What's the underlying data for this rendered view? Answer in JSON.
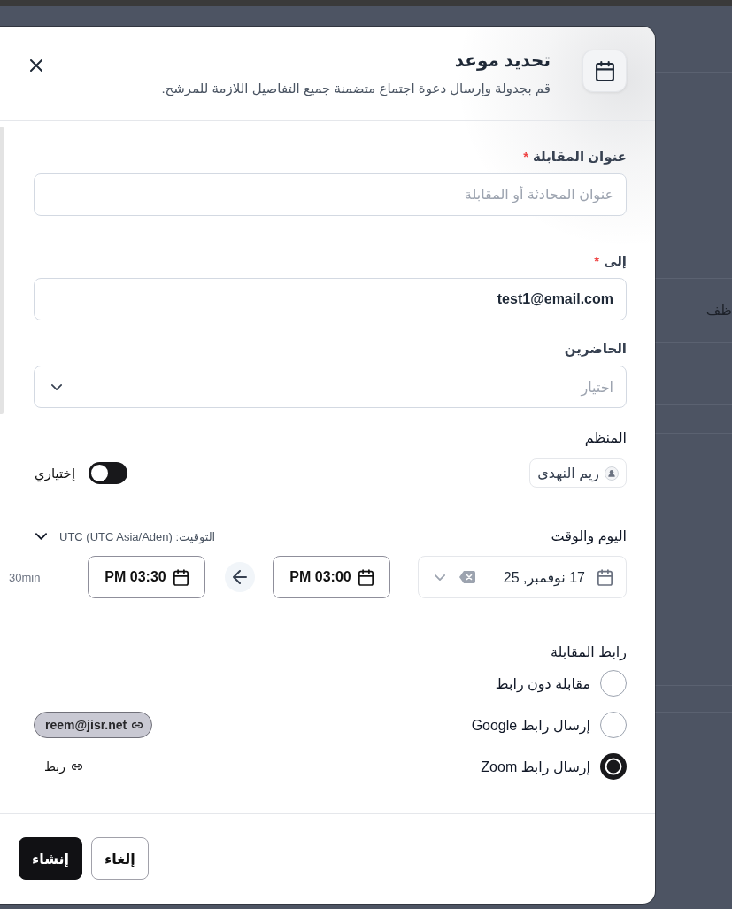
{
  "background": {
    "text": "ظف"
  },
  "dialog": {
    "title": "تحديد موعد",
    "subtitle": "قم بجدولة وإرسال دعوة اجتماع متضمنة جميع التفاصيل اللازمة للمرشح."
  },
  "fields": [
    {
      "kind": "text",
      "label": "عنوان المقابلة",
      "required_mark": "*",
      "placeholder": "عنوان المحادثة أو المقابلة"
    },
    {
      "kind": "text",
      "label": "إلى",
      "required_mark": "*",
      "value": "test1@email.com"
    },
    {
      "kind": "select",
      "label": "الحاضرين",
      "placeholder": "اختيار"
    }
  ],
  "organizer": {
    "label": "المنظم",
    "name": "ريم النهدى",
    "optional": {
      "label": "إختياري",
      "on": false
    }
  },
  "schedule": {
    "label": "اليوم والوقت",
    "timezone": "التوقيت: UTC (UTC Asia/Aden)",
    "date": "17 نوفمبر, 25",
    "start_time": "PM 03:00",
    "end_time": "PM 03:30",
    "duration": "30min"
  },
  "meeting_link": {
    "label": "رابط المقابلة",
    "options": [
      {
        "label": "مقابلة دون رابط",
        "selected": false
      },
      {
        "label": "إرسال رابط Google",
        "selected": false,
        "account": "reem@jisr.net"
      },
      {
        "label": "إرسال رابط Zoom",
        "selected": true,
        "action": "ربط"
      }
    ]
  },
  "buttons": [
    {
      "label": "إلغاء",
      "kind": "secondary"
    },
    {
      "label": "إنشاء",
      "kind": "primary"
    }
  ]
}
